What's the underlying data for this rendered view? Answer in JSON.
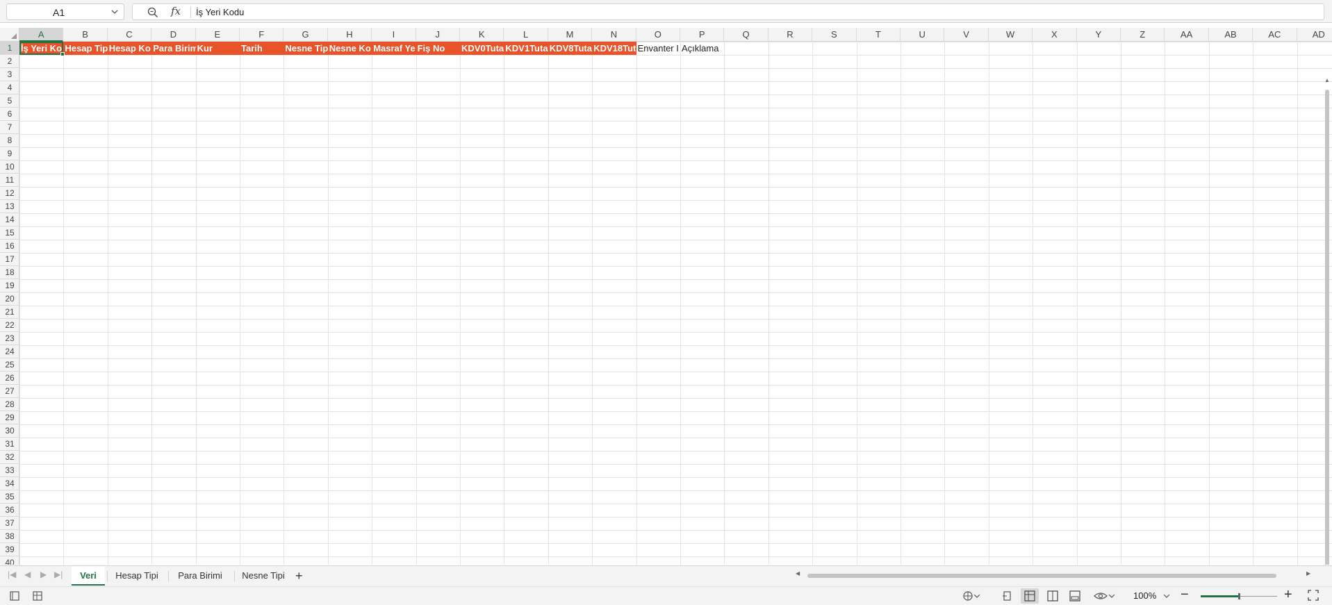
{
  "name_box": {
    "value": "A1"
  },
  "formula_bar": {
    "fx_label": "fx",
    "value": "İş Yeri Kodu"
  },
  "grid": {
    "selected_cell": "A1",
    "columns": [
      "A",
      "B",
      "C",
      "D",
      "E",
      "F",
      "G",
      "H",
      "I",
      "J",
      "K",
      "L",
      "M",
      "N",
      "O",
      "P",
      "Q",
      "R",
      "S",
      "T",
      "U",
      "V",
      "W",
      "X",
      "Y",
      "Z",
      "AA",
      "AB",
      "AC",
      "AD"
    ],
    "rows": [
      "1",
      "2",
      "3",
      "4",
      "5",
      "6",
      "7",
      "8",
      "9",
      "10",
      "11",
      "12",
      "13",
      "14",
      "15",
      "16",
      "17",
      "18",
      "19",
      "20",
      "21",
      "22",
      "23",
      "24",
      "25",
      "26",
      "27",
      "28",
      "29",
      "30",
      "31",
      "32",
      "33",
      "34",
      "35",
      "36",
      "37",
      "38",
      "39",
      "40"
    ],
    "header_row": [
      {
        "col": "A",
        "text": "İş Yeri Ko",
        "style": "orange"
      },
      {
        "col": "B",
        "text": "Hesap Tip",
        "style": "orange"
      },
      {
        "col": "C",
        "text": "Hesap Ko",
        "style": "orange"
      },
      {
        "col": "D",
        "text": "Para Birim",
        "style": "orange"
      },
      {
        "col": "E",
        "text": "Kur",
        "style": "orange"
      },
      {
        "col": "F",
        "text": "Tarih",
        "style": "orange"
      },
      {
        "col": "G",
        "text": "Nesne Tip",
        "style": "orange"
      },
      {
        "col": "H",
        "text": "Nesne Ko",
        "style": "orange"
      },
      {
        "col": "I",
        "text": "Masraf Ye",
        "style": "orange"
      },
      {
        "col": "J",
        "text": "Fiş No",
        "style": "orange"
      },
      {
        "col": "K",
        "text": "KDV0Tuta",
        "style": "orange"
      },
      {
        "col": "L",
        "text": "KDV1Tuta",
        "style": "orange"
      },
      {
        "col": "M",
        "text": "KDV8Tuta",
        "style": "orange"
      },
      {
        "col": "N",
        "text": "KDV18Tut",
        "style": "orange"
      },
      {
        "col": "O",
        "text": "Envanter I",
        "style": "plain"
      },
      {
        "col": "P",
        "text": "Açıklama",
        "style": "plain"
      }
    ]
  },
  "sheet_tabs": [
    {
      "label": "Veri",
      "active": true
    },
    {
      "label": "Hesap Tipi",
      "active": false
    },
    {
      "label": "Para Birimi",
      "active": false
    },
    {
      "label": "Nesne Tipi",
      "active": false
    }
  ],
  "add_sheet_label": "+",
  "status_bar": {
    "zoom_label": "100%",
    "zoom_minus": "−",
    "zoom_plus": "+",
    "zoom_level": 0.5
  },
  "colors": {
    "header_fill": "#e8532a",
    "accent": "#217346"
  },
  "icons": {
    "formula_zoom": "zoom-search-icon",
    "name_box_dropdown": "chevron-down-icon",
    "accessibility": "accessibility-icon",
    "view_normal": "normal-view-icon",
    "view_page_layout": "page-layout-view-icon",
    "view_page_break": "page-break-view-icon",
    "display_options": "eye-icon"
  }
}
